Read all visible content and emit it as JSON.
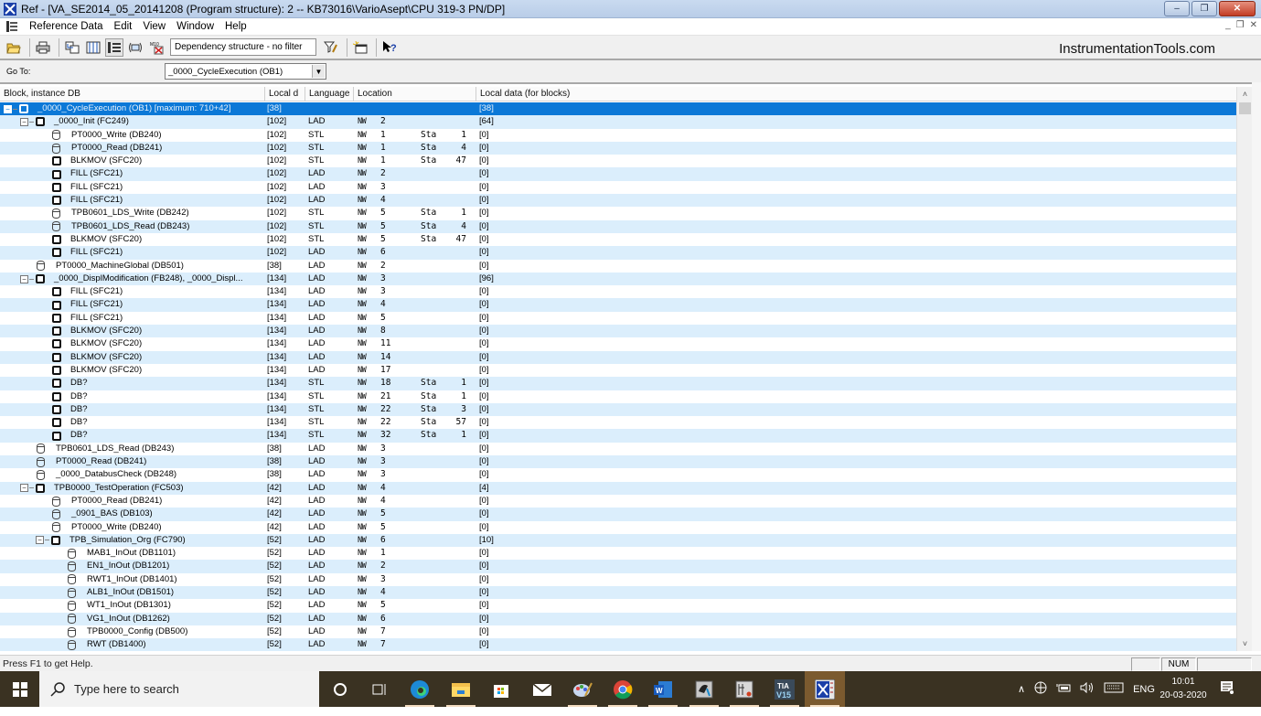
{
  "window": {
    "title": "Ref - [VA_SE2014_05_20141208 (Program structure): 2 -- KB73016\\VarioAsept\\CPU 319-3 PN/DP]",
    "buttons": {
      "minimize": "–",
      "restore": "❐",
      "close": "✕"
    },
    "mdi_buttons": {
      "minimize": "_",
      "restore": "❐",
      "close": "✕"
    }
  },
  "menu": {
    "items": [
      "Reference Data",
      "Edit",
      "View",
      "Window",
      "Help"
    ]
  },
  "toolbar": {
    "filter_text": "Dependency structure - no filter",
    "brand": "InstrumentationTools.com",
    "buttons": [
      "open-icon",
      "print-icon",
      "cross-reference-icon",
      "list-icon",
      "tree-icon",
      "unused-symbols-icon",
      "address-assignment-icon",
      "filter-icon",
      "new-window-icon",
      "context-help-icon"
    ]
  },
  "goto": {
    "label": "Go To:",
    "selected": "_0000_CycleExecution (OB1)",
    "dropdown_glyph": "▼"
  },
  "grid": {
    "columns": [
      "Block, instance DB",
      "Local d",
      "Language",
      "Location",
      "Local data (for blocks)"
    ],
    "rows": [
      {
        "level": 0,
        "type": "block",
        "expander": "−",
        "name": "_0000_CycleExecution (OB1) [maximum: 710+42]",
        "local": "[38]",
        "lang": "",
        "nw": "",
        "nwnum": "",
        "sta": "",
        "stanum": "",
        "ldata": "[38]",
        "selected": true
      },
      {
        "level": 1,
        "type": "block",
        "expander": "−",
        "name": "_0000_Init (FC249)",
        "local": "[102]",
        "lang": "LAD",
        "nw": "NW",
        "nwnum": "2",
        "sta": "",
        "stanum": "",
        "ldata": "[64]"
      },
      {
        "level": 2,
        "type": "db",
        "name": "PT0000_Write (DB240)",
        "local": "[102]",
        "lang": "STL",
        "nw": "NW",
        "nwnum": "1",
        "sta": "Sta",
        "stanum": "1",
        "ldata": "[0]"
      },
      {
        "level": 2,
        "type": "db",
        "name": "PT0000_Read (DB241)",
        "local": "[102]",
        "lang": "STL",
        "nw": "NW",
        "nwnum": "1",
        "sta": "Sta",
        "stanum": "4",
        "ldata": "[0]"
      },
      {
        "level": 2,
        "type": "block",
        "name": "BLKMOV (SFC20)",
        "local": "[102]",
        "lang": "STL",
        "nw": "NW",
        "nwnum": "1",
        "sta": "Sta",
        "stanum": "47",
        "ldata": "[0]"
      },
      {
        "level": 2,
        "type": "block",
        "name": "FILL (SFC21)",
        "local": "[102]",
        "lang": "LAD",
        "nw": "NW",
        "nwnum": "2",
        "sta": "",
        "stanum": "",
        "ldata": "[0]"
      },
      {
        "level": 2,
        "type": "block",
        "name": "FILL (SFC21)",
        "local": "[102]",
        "lang": "LAD",
        "nw": "NW",
        "nwnum": "3",
        "sta": "",
        "stanum": "",
        "ldata": "[0]"
      },
      {
        "level": 2,
        "type": "block",
        "name": "FILL (SFC21)",
        "local": "[102]",
        "lang": "LAD",
        "nw": "NW",
        "nwnum": "4",
        "sta": "",
        "stanum": "",
        "ldata": "[0]"
      },
      {
        "level": 2,
        "type": "db",
        "name": "TPB0601_LDS_Write (DB242)",
        "local": "[102]",
        "lang": "STL",
        "nw": "NW",
        "nwnum": "5",
        "sta": "Sta",
        "stanum": "1",
        "ldata": "[0]"
      },
      {
        "level": 2,
        "type": "db",
        "name": "TPB0601_LDS_Read (DB243)",
        "local": "[102]",
        "lang": "STL",
        "nw": "NW",
        "nwnum": "5",
        "sta": "Sta",
        "stanum": "4",
        "ldata": "[0]"
      },
      {
        "level": 2,
        "type": "block",
        "name": "BLKMOV (SFC20)",
        "local": "[102]",
        "lang": "STL",
        "nw": "NW",
        "nwnum": "5",
        "sta": "Sta",
        "stanum": "47",
        "ldata": "[0]"
      },
      {
        "level": 2,
        "type": "block",
        "name": "FILL (SFC21)",
        "local": "[102]",
        "lang": "LAD",
        "nw": "NW",
        "nwnum": "6",
        "sta": "",
        "stanum": "",
        "ldata": "[0]"
      },
      {
        "level": 1,
        "type": "db",
        "name": "PT0000_MachineGlobal (DB501)",
        "local": "[38]",
        "lang": "LAD",
        "nw": "NW",
        "nwnum": "2",
        "sta": "",
        "stanum": "",
        "ldata": "[0]"
      },
      {
        "level": 1,
        "type": "block",
        "expander": "−",
        "name": "_0000_DisplModification (FB248), _0000_Displ...",
        "local": "[134]",
        "lang": "LAD",
        "nw": "NW",
        "nwnum": "3",
        "sta": "",
        "stanum": "",
        "ldata": "[96]"
      },
      {
        "level": 2,
        "type": "block",
        "name": "FILL (SFC21)",
        "local": "[134]",
        "lang": "LAD",
        "nw": "NW",
        "nwnum": "3",
        "sta": "",
        "stanum": "",
        "ldata": "[0]"
      },
      {
        "level": 2,
        "type": "block",
        "name": "FILL (SFC21)",
        "local": "[134]",
        "lang": "LAD",
        "nw": "NW",
        "nwnum": "4",
        "sta": "",
        "stanum": "",
        "ldata": "[0]"
      },
      {
        "level": 2,
        "type": "block",
        "name": "FILL (SFC21)",
        "local": "[134]",
        "lang": "LAD",
        "nw": "NW",
        "nwnum": "5",
        "sta": "",
        "stanum": "",
        "ldata": "[0]"
      },
      {
        "level": 2,
        "type": "block",
        "name": "BLKMOV (SFC20)",
        "local": "[134]",
        "lang": "LAD",
        "nw": "NW",
        "nwnum": "8",
        "sta": "",
        "stanum": "",
        "ldata": "[0]"
      },
      {
        "level": 2,
        "type": "block",
        "name": "BLKMOV (SFC20)",
        "local": "[134]",
        "lang": "LAD",
        "nw": "NW",
        "nwnum": "11",
        "sta": "",
        "stanum": "",
        "ldata": "[0]"
      },
      {
        "level": 2,
        "type": "block",
        "name": "BLKMOV (SFC20)",
        "local": "[134]",
        "lang": "LAD",
        "nw": "NW",
        "nwnum": "14",
        "sta": "",
        "stanum": "",
        "ldata": "[0]"
      },
      {
        "level": 2,
        "type": "block",
        "name": "BLKMOV (SFC20)",
        "local": "[134]",
        "lang": "LAD",
        "nw": "NW",
        "nwnum": "17",
        "sta": "",
        "stanum": "",
        "ldata": "[0]"
      },
      {
        "level": 2,
        "type": "block",
        "name": "DB?",
        "local": "[134]",
        "lang": "STL",
        "nw": "NW",
        "nwnum": "18",
        "sta": "Sta",
        "stanum": "1",
        "ldata": "[0]"
      },
      {
        "level": 2,
        "type": "block",
        "name": "DB?",
        "local": "[134]",
        "lang": "STL",
        "nw": "NW",
        "nwnum": "21",
        "sta": "Sta",
        "stanum": "1",
        "ldata": "[0]"
      },
      {
        "level": 2,
        "type": "block",
        "name": "DB?",
        "local": "[134]",
        "lang": "STL",
        "nw": "NW",
        "nwnum": "22",
        "sta": "Sta",
        "stanum": "3",
        "ldata": "[0]"
      },
      {
        "level": 2,
        "type": "block",
        "name": "DB?",
        "local": "[134]",
        "lang": "STL",
        "nw": "NW",
        "nwnum": "22",
        "sta": "Sta",
        "stanum": "57",
        "ldata": "[0]"
      },
      {
        "level": 2,
        "type": "block",
        "name": "DB?",
        "local": "[134]",
        "lang": "STL",
        "nw": "NW",
        "nwnum": "32",
        "sta": "Sta",
        "stanum": "1",
        "ldata": "[0]"
      },
      {
        "level": 1,
        "type": "db",
        "name": "TPB0601_LDS_Read (DB243)",
        "local": "[38]",
        "lang": "LAD",
        "nw": "NW",
        "nwnum": "3",
        "sta": "",
        "stanum": "",
        "ldata": "[0]"
      },
      {
        "level": 1,
        "type": "db",
        "name": "PT0000_Read (DB241)",
        "local": "[38]",
        "lang": "LAD",
        "nw": "NW",
        "nwnum": "3",
        "sta": "",
        "stanum": "",
        "ldata": "[0]"
      },
      {
        "level": 1,
        "type": "db",
        "name": "_0000_DatabusCheck (DB248)",
        "local": "[38]",
        "lang": "LAD",
        "nw": "NW",
        "nwnum": "3",
        "sta": "",
        "stanum": "",
        "ldata": "[0]"
      },
      {
        "level": 1,
        "type": "block",
        "expander": "−",
        "name": "TPB0000_TestOperation (FC503)",
        "local": "[42]",
        "lang": "LAD",
        "nw": "NW",
        "nwnum": "4",
        "sta": "",
        "stanum": "",
        "ldata": "[4]"
      },
      {
        "level": 2,
        "type": "db",
        "name": "PT0000_Read (DB241)",
        "local": "[42]",
        "lang": "LAD",
        "nw": "NW",
        "nwnum": "4",
        "sta": "",
        "stanum": "",
        "ldata": "[0]"
      },
      {
        "level": 2,
        "type": "db",
        "name": "_0901_BAS (DB103)",
        "local": "[42]",
        "lang": "LAD",
        "nw": "NW",
        "nwnum": "5",
        "sta": "",
        "stanum": "",
        "ldata": "[0]"
      },
      {
        "level": 2,
        "type": "db",
        "name": "PT0000_Write (DB240)",
        "local": "[42]",
        "lang": "LAD",
        "nw": "NW",
        "nwnum": "5",
        "sta": "",
        "stanum": "",
        "ldata": "[0]"
      },
      {
        "level": 2,
        "type": "block",
        "expander": "−",
        "name": "TPB_Simulation_Org (FC790)",
        "local": "[52]",
        "lang": "LAD",
        "nw": "NW",
        "nwnum": "6",
        "sta": "",
        "stanum": "",
        "ldata": "[10]"
      },
      {
        "level": 3,
        "type": "db",
        "name": "MAB1_InOut (DB1101)",
        "local": "[52]",
        "lang": "LAD",
        "nw": "NW",
        "nwnum": "1",
        "sta": "",
        "stanum": "",
        "ldata": "[0]"
      },
      {
        "level": 3,
        "type": "db",
        "name": "EN1_InOut (DB1201)",
        "local": "[52]",
        "lang": "LAD",
        "nw": "NW",
        "nwnum": "2",
        "sta": "",
        "stanum": "",
        "ldata": "[0]"
      },
      {
        "level": 3,
        "type": "db",
        "name": "RWT1_InOut (DB1401)",
        "local": "[52]",
        "lang": "LAD",
        "nw": "NW",
        "nwnum": "3",
        "sta": "",
        "stanum": "",
        "ldata": "[0]"
      },
      {
        "level": 3,
        "type": "db",
        "name": "ALB1_InOut (DB1501)",
        "local": "[52]",
        "lang": "LAD",
        "nw": "NW",
        "nwnum": "4",
        "sta": "",
        "stanum": "",
        "ldata": "[0]"
      },
      {
        "level": 3,
        "type": "db",
        "name": "WT1_InOut (DB1301)",
        "local": "[52]",
        "lang": "LAD",
        "nw": "NW",
        "nwnum": "5",
        "sta": "",
        "stanum": "",
        "ldata": "[0]"
      },
      {
        "level": 3,
        "type": "db",
        "name": "VG1_InOut (DB1262)",
        "local": "[52]",
        "lang": "LAD",
        "nw": "NW",
        "nwnum": "6",
        "sta": "",
        "stanum": "",
        "ldata": "[0]"
      },
      {
        "level": 3,
        "type": "db",
        "name": "TPB0000_Config (DB500)",
        "local": "[52]",
        "lang": "LAD",
        "nw": "NW",
        "nwnum": "7",
        "sta": "",
        "stanum": "",
        "ldata": "[0]"
      },
      {
        "level": 3,
        "type": "db",
        "name": "RWT (DB1400)",
        "local": "[52]",
        "lang": "LAD",
        "nw": "NW",
        "nwnum": "7",
        "sta": "",
        "stanum": "",
        "ldata": "[0]"
      }
    ]
  },
  "scrollbar": {
    "up": "˄",
    "down": "˅"
  },
  "status": {
    "text": "Press F1 to get Help.",
    "panes": [
      "",
      "NUM",
      ""
    ]
  },
  "taskbar": {
    "search_placeholder": "Type here to search",
    "apps": [
      "cortana-icon",
      "task-view-icon",
      "edge-icon",
      "file-explorer-icon",
      "store-icon",
      "mail-icon",
      "paint-icon",
      "chrome-icon",
      "word-icon",
      "simatic-manager-icon",
      "simatic-hw-config-icon",
      "tia-portal-icon",
      "reference-data-icon"
    ],
    "tia_label": "TIA\nV15",
    "tray": {
      "chevron": "∧",
      "language": "ENG"
    },
    "clock": {
      "time": "10:01",
      "date": "20-03-2020"
    }
  }
}
